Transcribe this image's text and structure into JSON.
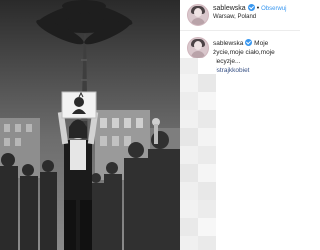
{
  "post": {
    "username": "sablewska",
    "follow_label": "Obserwuj",
    "location": "Warsaw, Poland",
    "caption": {
      "username": "sablewska",
      "text": "Moje życie,moje ciało,moje decyzje...",
      "hashtag": "#strajkkobiet"
    },
    "photo": {
      "description_icon": "protest-photo",
      "sign_icon": "protest-sign-icon"
    }
  },
  "colors": {
    "link": "#3897f0",
    "hashtag": "#385185",
    "text": "#262626"
  }
}
